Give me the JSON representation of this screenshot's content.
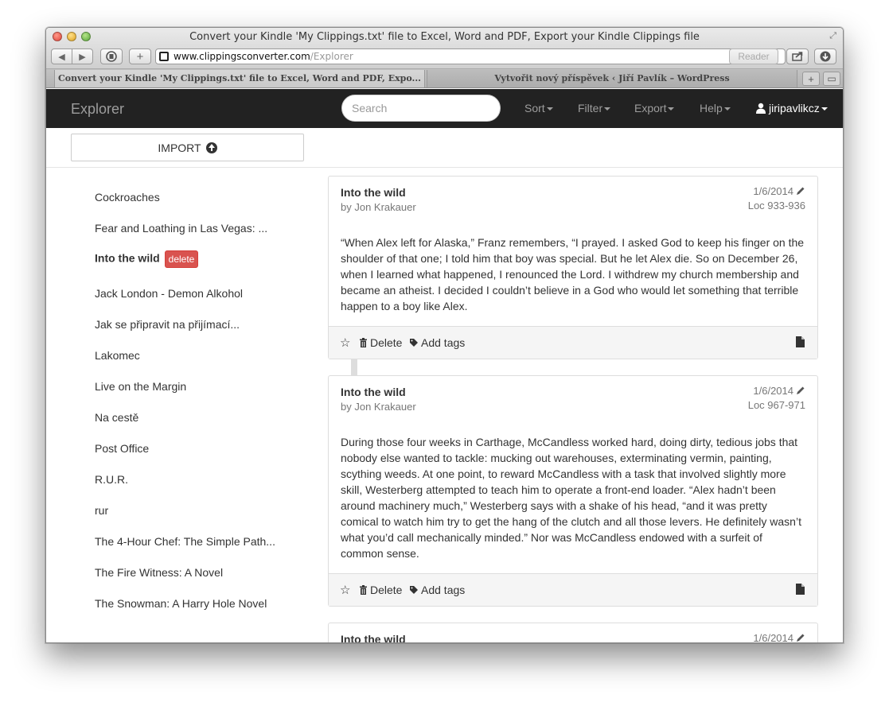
{
  "window": {
    "title": "Convert your Kindle 'My Clippings.txt' file to Excel, Word and PDF, Export your Kindle Clippings file",
    "url_host": "www.clippingsconverter.com",
    "url_path": "/Explorer",
    "reader_label": "Reader"
  },
  "tabs": [
    {
      "label": "Convert your Kindle 'My Clippings.txt' file to Excel, Word and PDF, Expo..."
    },
    {
      "label": "Vytvořit nový příspěvek ‹ Jiří Pavlík – WordPress"
    }
  ],
  "navbar": {
    "brand": "Explorer",
    "search_placeholder": "Search",
    "sort": "Sort",
    "filter": "Filter",
    "export": "Export",
    "help": "Help",
    "user": "jiripavlikcz"
  },
  "import_label": "IMPORT",
  "books": [
    {
      "title": "Cockroaches"
    },
    {
      "title": "Fear and Loathing in Las Vegas: ..."
    },
    {
      "title": "Into the wild",
      "badge": "delete"
    },
    {
      "title": "Jack London - Demon Alkohol"
    },
    {
      "title": "Jak se připravit na přijímací..."
    },
    {
      "title": "Lakomec"
    },
    {
      "title": "Live on the Margin"
    },
    {
      "title": "Na cestě"
    },
    {
      "title": "Post Office"
    },
    {
      "title": "R.U.R."
    },
    {
      "title": "rur"
    },
    {
      "title": "The 4-Hour Chef: The Simple Path..."
    },
    {
      "title": "The Fire Witness: A Novel"
    },
    {
      "title": "The Snowman: A Harry Hole Novel"
    }
  ],
  "clippings": [
    {
      "title": "Into the wild",
      "author": "by Jon Krakauer",
      "date": "1/6/2014",
      "location": "Loc 933-936",
      "text": "“When Alex left for Alaska,” Franz remembers, “I prayed. I asked God to keep his finger on the shoulder of that one; I told him that boy was special. But he let Alex die. So on December 26, when I learned what happened, I renounced the Lord. I withdrew my church membership and became an atheist. I decided I couldn’t believe in a God who would let something that terrible happen to a boy like Alex.",
      "delete_label": "Delete",
      "tags_label": "Add tags"
    },
    {
      "title": "Into the wild",
      "author": "by Jon Krakauer",
      "date": "1/6/2014",
      "location": "Loc 967-971",
      "text": "During those four weeks in Carthage, McCandless worked hard, doing dirty, tedious jobs that nobody else wanted to tackle: mucking out warehouses, exterminating vermin, painting, scything weeds. At one point, to reward McCandless with a task that involved slightly more skill, Westerberg attempted to teach him to operate a front-end loader. “Alex hadn’t been around machinery much,” Westerberg says with a shake of his head, “and it was pretty comical to watch him try to get the hang of the clutch and all those levers. He definitely wasn’t what you’d call mechanically minded.” Nor was McCandless endowed with a surfeit of common sense.",
      "delete_label": "Delete",
      "tags_label": "Add tags"
    },
    {
      "title": "Into the wild",
      "date": "1/6/2014"
    }
  ],
  "colors": {
    "navbar_bg": "#222222",
    "navbar_text": "#9d9d9d",
    "delete_badge": "#d9534f",
    "footer_bg": "#f5f5f5"
  }
}
